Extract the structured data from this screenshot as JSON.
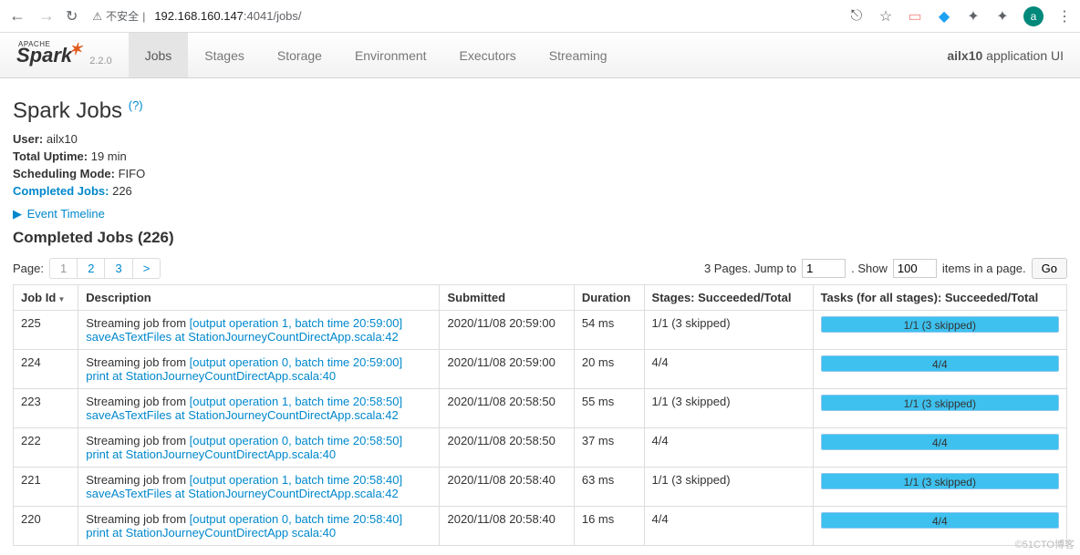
{
  "browser": {
    "insecure_label": "不安全",
    "url_host": "192.168.160.147",
    "url_port_path": ":4041/jobs/",
    "avatar_letter": "a"
  },
  "nav": {
    "brand_small": "APACHE",
    "brand": "Spark",
    "version": "2.2.0",
    "tabs": [
      "Jobs",
      "Stages",
      "Storage",
      "Environment",
      "Executors",
      "Streaming"
    ],
    "active_tab": 0,
    "app_name": "ailx10",
    "app_suffix": "application UI"
  },
  "page": {
    "title": "Spark Jobs",
    "help": "(?)",
    "meta": {
      "user_label": "User:",
      "user_value": "ailx10",
      "uptime_label": "Total Uptime:",
      "uptime_value": "19 min",
      "mode_label": "Scheduling Mode:",
      "mode_value": "FIFO",
      "completed_label": "Completed Jobs:",
      "completed_value": "226"
    },
    "timeline": "Event Timeline",
    "section_title": "Completed Jobs (226)"
  },
  "pager": {
    "label": "Page:",
    "pages": [
      "1",
      "2",
      "3",
      ">"
    ],
    "current_index": 0,
    "summary_prefix": "3 Pages. Jump to",
    "jump_value": "1",
    "show_label": ". Show",
    "show_value": "100",
    "suffix": "items in a page.",
    "go": "Go"
  },
  "table": {
    "headers": [
      "Job Id",
      "Description",
      "Submitted",
      "Duration",
      "Stages: Succeeded/Total",
      "Tasks (for all stages): Succeeded/Total"
    ],
    "rows": [
      {
        "id": "225",
        "desc_prefix": "Streaming job from ",
        "link1": "[output operation 1, batch time 20:59:00]",
        "link2": "saveAsTextFiles at StationJourneyCountDirectApp.scala:42",
        "submitted": "2020/11/08 20:59:00",
        "duration": "54 ms",
        "stages": "1/1 (3 skipped)",
        "tasks": "1/1 (3 skipped)",
        "pct": 100
      },
      {
        "id": "224",
        "desc_prefix": "Streaming job from ",
        "link1": "[output operation 0, batch time 20:59:00]",
        "link2": "print at StationJourneyCountDirectApp.scala:40",
        "submitted": "2020/11/08 20:59:00",
        "duration": "20 ms",
        "stages": "4/4",
        "tasks": "4/4",
        "pct": 100
      },
      {
        "id": "223",
        "desc_prefix": "Streaming job from ",
        "link1": "[output operation 1, batch time 20:58:50]",
        "link2": "saveAsTextFiles at StationJourneyCountDirectApp.scala:42",
        "submitted": "2020/11/08 20:58:50",
        "duration": "55 ms",
        "stages": "1/1 (3 skipped)",
        "tasks": "1/1 (3 skipped)",
        "pct": 100
      },
      {
        "id": "222",
        "desc_prefix": "Streaming job from ",
        "link1": "[output operation 0, batch time 20:58:50]",
        "link2": "print at StationJourneyCountDirectApp.scala:40",
        "submitted": "2020/11/08 20:58:50",
        "duration": "37 ms",
        "stages": "4/4",
        "tasks": "4/4",
        "pct": 100
      },
      {
        "id": "221",
        "desc_prefix": "Streaming job from ",
        "link1": "[output operation 1, batch time 20:58:40]",
        "link2": "saveAsTextFiles at StationJourneyCountDirectApp.scala:42",
        "submitted": "2020/11/08 20:58:40",
        "duration": "63 ms",
        "stages": "1/1 (3 skipped)",
        "tasks": "1/1 (3 skipped)",
        "pct": 100
      },
      {
        "id": "220",
        "desc_prefix": "Streaming job from ",
        "link1": "[output operation 0, batch time 20:58:40]",
        "link2": "print at StationJourneyCountDirectApp scala:40",
        "submitted": "2020/11/08 20:58:40",
        "duration": "16 ms",
        "stages": "4/4",
        "tasks": "4/4",
        "pct": 100
      }
    ]
  },
  "watermark": "©51CTO博客"
}
